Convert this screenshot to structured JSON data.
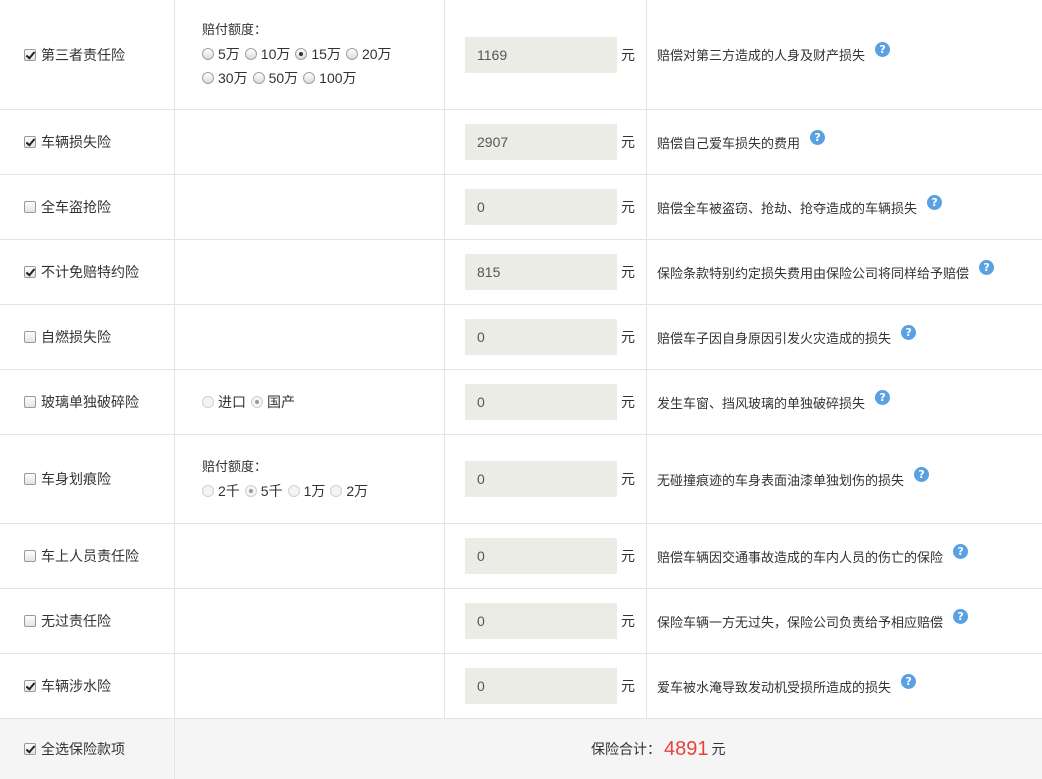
{
  "items": [
    {
      "name": "第三者责任险",
      "checked": true,
      "options": {
        "title": "赔付额度：",
        "lines": [
          [
            {
              "label": "5万",
              "selected": false
            },
            {
              "label": "10万",
              "selected": false
            },
            {
              "label": "15万",
              "selected": true
            },
            {
              "label": "20万",
              "selected": false
            }
          ],
          [
            {
              "label": "30万",
              "selected": false
            },
            {
              "label": "50万",
              "selected": false
            },
            {
              "label": "100万",
              "selected": false
            }
          ]
        ]
      },
      "price": "1169",
      "unit": "元",
      "desc": "赔偿对第三方造成的人身及财产损失",
      "help": "?"
    },
    {
      "name": "车辆损失险",
      "checked": true,
      "price": "2907",
      "unit": "元",
      "desc": "赔偿自己爱车损失的费用",
      "help": "?"
    },
    {
      "name": "全车盗抢险",
      "checked": false,
      "price": "0",
      "unit": "元",
      "desc": "赔偿全车被盗窃、抢劫、抢夺造成的车辆损失",
      "help": "?"
    },
    {
      "name": "不计免赔特约险",
      "checked": true,
      "price": "815",
      "unit": "元",
      "desc": "保险条款特别约定损失费用由保险公司将同样给予赔偿",
      "help": "?"
    },
    {
      "name": "自燃损失险",
      "checked": false,
      "price": "0",
      "unit": "元",
      "desc": "赔偿车子因自身原因引发火灾造成的损失",
      "help": "?"
    },
    {
      "name": "玻璃单独破碎险",
      "checked": false,
      "options": {
        "title": "",
        "lines": [
          [
            {
              "label": "进口",
              "selected": false
            },
            {
              "label": "国产",
              "selected": true
            }
          ]
        ]
      },
      "price": "0",
      "unit": "元",
      "desc": "发生车窗、挡风玻璃的单独破碎损失",
      "help": "?"
    },
    {
      "name": "车身划痕险",
      "checked": false,
      "options": {
        "title": "赔付额度：",
        "lines": [
          [
            {
              "label": "2千",
              "selected": false
            },
            {
              "label": "5千",
              "selected": true
            },
            {
              "label": "1万",
              "selected": false
            },
            {
              "label": "2万",
              "selected": false
            }
          ]
        ]
      },
      "price": "0",
      "unit": "元",
      "desc": "无碰撞痕迹的车身表面油漆单独划伤的损失",
      "help": "?"
    },
    {
      "name": "车上人员责任险",
      "checked": false,
      "price": "0",
      "unit": "元",
      "desc": "赔偿车辆因交通事故造成的车内人员的伤亡的保险",
      "help": "?"
    },
    {
      "name": "无过责任险",
      "checked": false,
      "price": "0",
      "unit": "元",
      "desc": "保险车辆一方无过失，保险公司负责给予相应赔偿",
      "help": "?"
    },
    {
      "name": "车辆涉水险",
      "checked": true,
      "price": "0",
      "unit": "元",
      "desc": "爱车被水淹导致发动机受损所造成的损失",
      "help": "?"
    }
  ],
  "footer": {
    "select_all_label": "全选保险款项",
    "select_all_checked": true,
    "total_label": "保险合计：",
    "total_value": "4891",
    "total_unit": "元"
  },
  "colors": {
    "total_value": "#e8423a",
    "help_icon": "#5aa1e3",
    "price_box_bg": "#ecece7",
    "footer_bg": "#f5f5f5"
  }
}
